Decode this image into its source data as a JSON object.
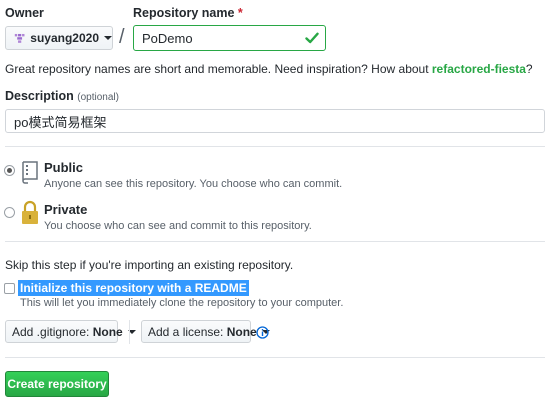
{
  "owner": {
    "label": "Owner",
    "value": "suyang2020"
  },
  "repo": {
    "label": "Repository name",
    "required_mark": "*",
    "value": "PoDemo"
  },
  "separator": "/",
  "inspiration": {
    "text": "Great repository names are short and memorable. Need inspiration? How about ",
    "suggestion": "refactored-fiesta",
    "end": "?"
  },
  "description": {
    "label": "Description",
    "optional": "(optional)",
    "value": "po模式简易框架"
  },
  "visibility": {
    "public": {
      "title": "Public",
      "note": "Anyone can see this repository. You choose who can commit.",
      "selected": true
    },
    "private": {
      "title": "Private",
      "note": "You choose who can see and commit to this repository.",
      "selected": false
    }
  },
  "skip_note": "Skip this step if you're importing an existing repository.",
  "readme": {
    "label": "Initialize this repository with a README",
    "note": "This will let you immediately clone the repository to your computer.",
    "checked": false
  },
  "gitignore": {
    "prefix": "Add .gitignore:",
    "value": "None"
  },
  "license": {
    "prefix": "Add a license:",
    "value": "None"
  },
  "create_button": "Create repository",
  "colors": {
    "accent": "#28a745",
    "link": "#0366d6",
    "selection": "#3399ff"
  }
}
